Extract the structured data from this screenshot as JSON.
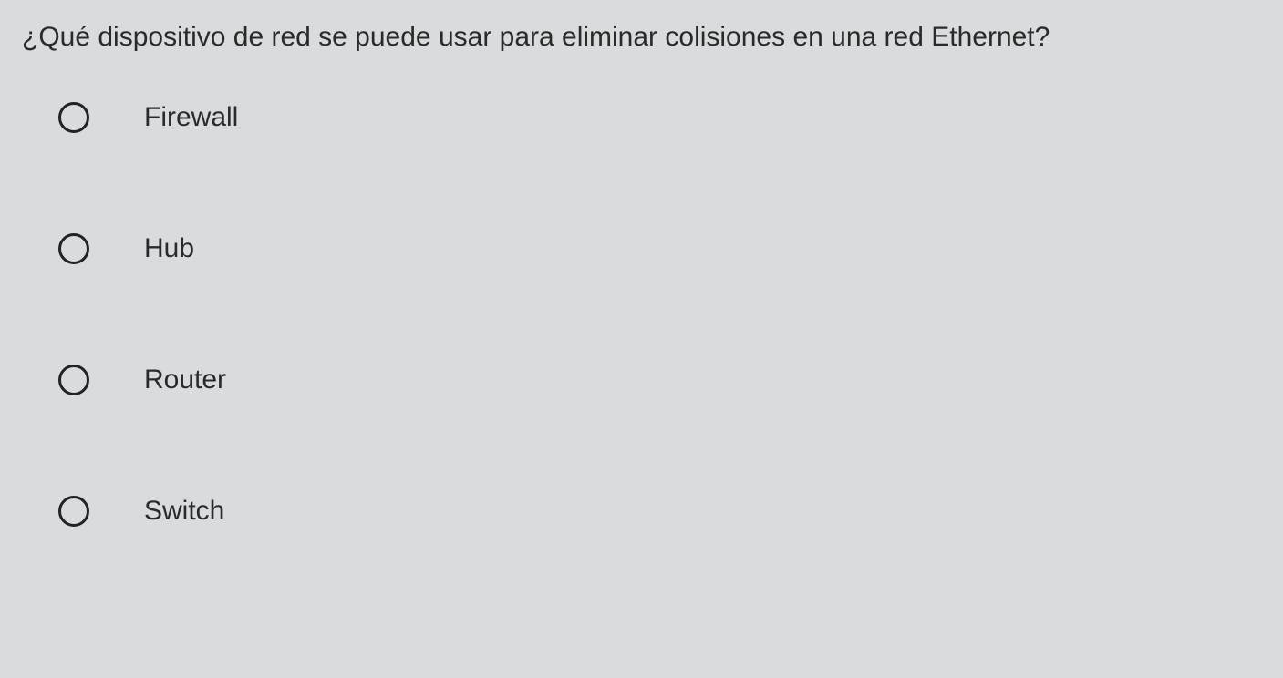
{
  "question": {
    "text": "¿Qué dispositivo de red se puede usar para eliminar colisiones en una red Ethernet?"
  },
  "options": [
    {
      "label": "Firewall"
    },
    {
      "label": "Hub"
    },
    {
      "label": "Router"
    },
    {
      "label": "Switch"
    }
  ]
}
